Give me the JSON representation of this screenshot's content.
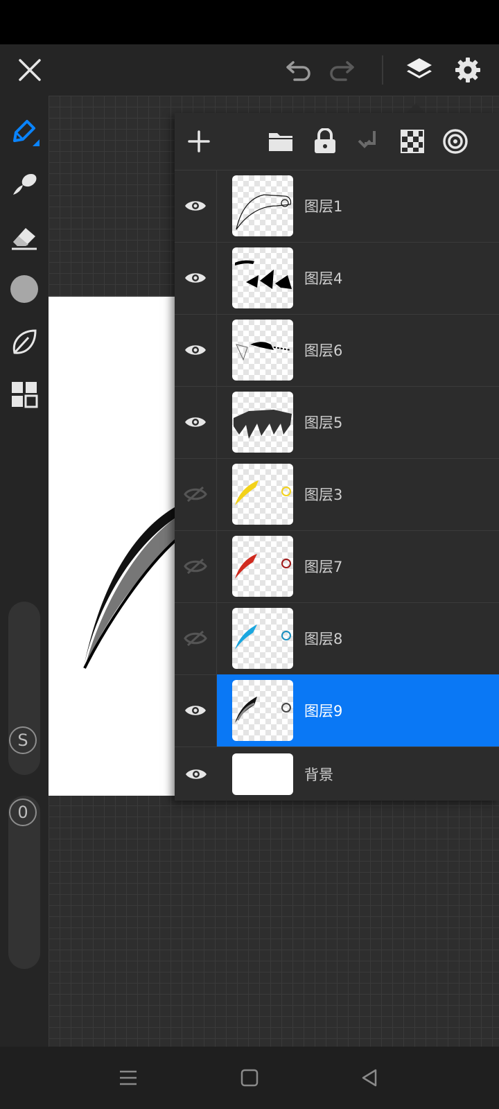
{
  "colors": {
    "accent": "#0a78f5",
    "panel_bg": "#2c2c2c",
    "toolbar_bg": "#252525"
  },
  "top_bar": {
    "close_icon": "close-icon",
    "undo_icon": "undo-icon",
    "redo_icon": "redo-icon",
    "layers_icon": "layers-icon",
    "settings_icon": "gear-icon"
  },
  "left_toolbar": {
    "tools": [
      "pencil-icon",
      "smudge-icon",
      "eraser-icon",
      "color-swatch",
      "leaf-icon",
      "grid-icon"
    ],
    "size_badge": "S",
    "opacity_badge": "0"
  },
  "layers_panel": {
    "toolbar": [
      "add-icon",
      "folder-icon",
      "lock-icon",
      "merge-down-icon",
      "transparency-icon",
      "spiral-icon"
    ],
    "layers": [
      {
        "name": "图层1",
        "visible": true,
        "selected": false
      },
      {
        "name": "图层4",
        "visible": true,
        "selected": false
      },
      {
        "name": "图层6",
        "visible": true,
        "selected": false
      },
      {
        "name": "图层5",
        "visible": true,
        "selected": false
      },
      {
        "name": "图层3",
        "visible": false,
        "selected": false
      },
      {
        "name": "图层7",
        "visible": false,
        "selected": false
      },
      {
        "name": "图层8",
        "visible": false,
        "selected": false
      },
      {
        "name": "图层9",
        "visible": true,
        "selected": true
      },
      {
        "name": "背景",
        "visible": true,
        "selected": false
      }
    ]
  },
  "nav_bar": {
    "menu_icon": "menu-icon",
    "home_icon": "home-icon",
    "back_icon": "back-icon"
  }
}
